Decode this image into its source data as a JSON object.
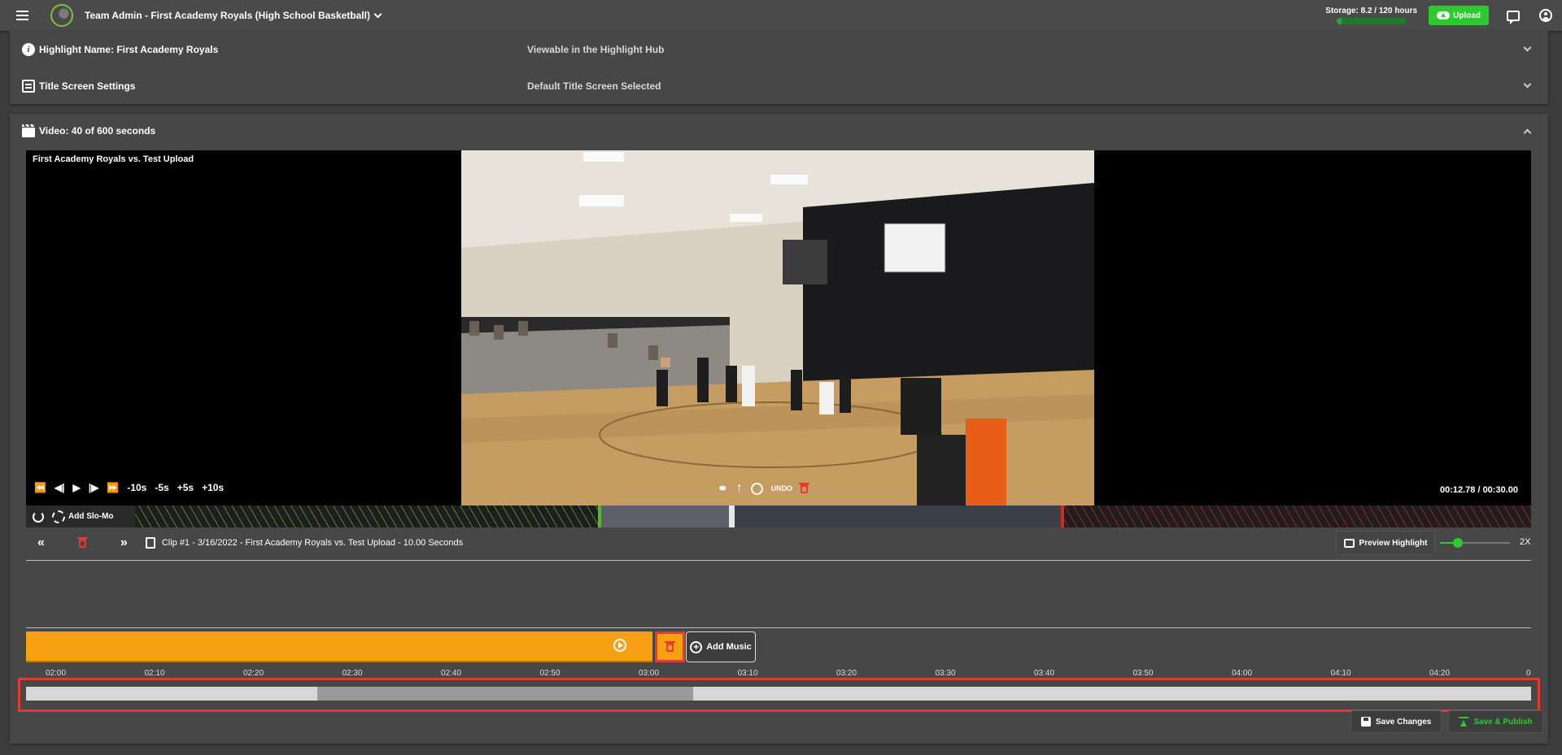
{
  "header": {
    "team_title": "Team Admin - First Academy Royals (High School Basketball)",
    "storage_label": "Storage: 8.2 / 120 hours",
    "storage_fraction": 0.068,
    "upload_label": "Upload"
  },
  "settings": {
    "highlight_label": "Highlight Name: First Academy Royals",
    "highlight_value": "Viewable in the Highlight Hub",
    "title_label": "Title Screen Settings",
    "title_value": "Default Title Screen Selected"
  },
  "video_panel": {
    "label": "Video: 40 of 600 seconds",
    "caption": "First Academy Royals vs. Test Upload",
    "time": "00:12.78 / 00:30.00",
    "skip": [
      "-10s",
      "-5s",
      "+5s",
      "+10s"
    ],
    "undo_label": "UNDO",
    "slomo_label": "Add Slo-Mo"
  },
  "clip": {
    "label": "Clip #1 - 3/16/2022 - First Academy Royals vs. Test Upload - 10.00 Seconds",
    "preview_label": "Preview Highlight",
    "speed_label": "2X",
    "speed_fraction": 0.25
  },
  "music": {
    "add_label": "Add Music"
  },
  "timeline": {
    "ticks": [
      "02:00",
      "02:10",
      "02:20",
      "02:30",
      "02:40",
      "02:50",
      "03:00",
      "03:10",
      "03:20",
      "03:30",
      "03:40",
      "03:50",
      "04:00",
      "04:10",
      "04:20",
      "0"
    ]
  },
  "footer": {
    "save_label": "Save Changes",
    "publish_label": "Save & Publish"
  },
  "colors": {
    "accent_green": "#2ec92e",
    "music_orange": "#f7a013",
    "danger_red": "#e53935"
  }
}
